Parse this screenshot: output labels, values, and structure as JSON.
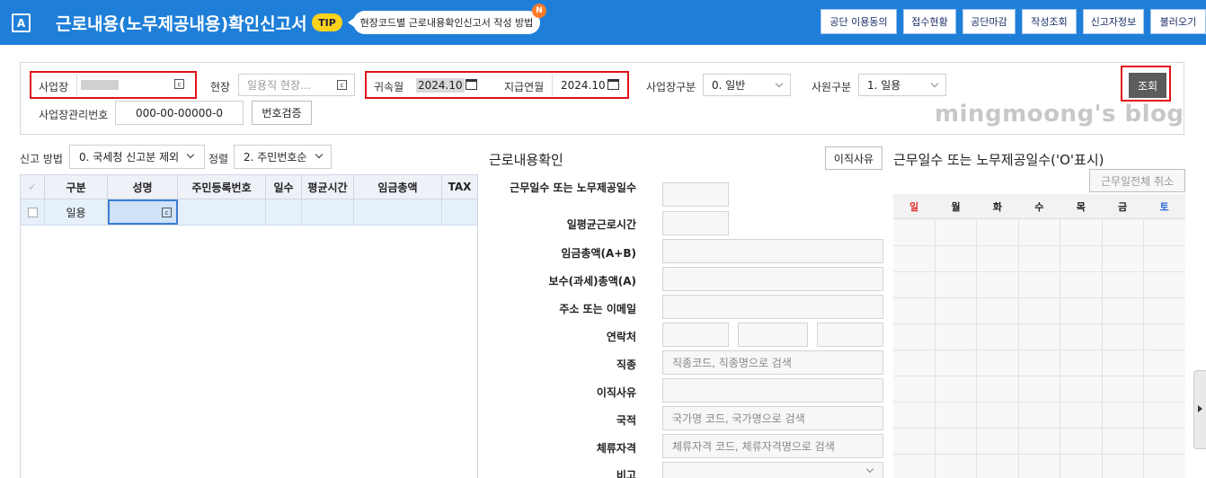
{
  "header": {
    "app_icon": "A",
    "title": "근로내용(노무제공내용)확인신고서",
    "tip_badge": "TIP",
    "tip_text": "현장코드별 근로내용확인신고서 작성 방법",
    "new_badge": "N",
    "buttons": [
      "공단 이용동의",
      "접수현황",
      "공단마감",
      "작성조회",
      "신고자정보",
      "불러오기"
    ]
  },
  "search": {
    "business_label": "사업장",
    "site_label": "현장",
    "site_placeholder": "일용직 현장…",
    "belong_month_label": "귀속월",
    "belong_month_value": "2024.10",
    "pay_month_label": "지급연월",
    "pay_month_value": "2024.10",
    "business_type_label": "사업장구분",
    "business_type_value": "0. 일반",
    "employee_type_label": "사원구분",
    "employee_type_value": "1. 일용",
    "search_button": "조회",
    "mgmt_no_label": "사업장관리번호",
    "mgmt_no_value": "000-00-00000-0",
    "verify_button": "번호검증"
  },
  "watermark": "mingmoong's blog",
  "filters": {
    "report_method_label": "신고 방법",
    "report_method_value": "0. 국세청 신고분 제외",
    "sort_label": "정렬",
    "sort_value": "2. 주민번호순"
  },
  "grid": {
    "columns": [
      "구분",
      "성명",
      "주민등록번호",
      "일수",
      "평균시간",
      "임금총액",
      "TAX"
    ],
    "rows": [
      {
        "type": "일용",
        "name": "",
        "rrn": "",
        "days": "",
        "avg_hours": "",
        "total_wage": "",
        "tax": ""
      }
    ]
  },
  "detail": {
    "title": "근로내용확인",
    "resign_reason_button": "이직사유",
    "fields": {
      "work_days": "근무일수 또는 노무제공일수",
      "daily_hours": "일평균근로시간",
      "total_wage": "임금총액(A+B)",
      "taxable_pay": "보수(과세)총액(A)",
      "address": "주소 또는 이메일",
      "contact": "연락처",
      "job": "직종",
      "resign_reason": "이직사유",
      "nationality": "국적",
      "stay_status": "체류자격",
      "note": "비고"
    },
    "placeholders": {
      "job": "직종코드, 직종명으로 검색",
      "nationality": "국가명 코드, 국가명으로 검색",
      "stay_status": "체류자격 코드, 체류자격명으로 검색"
    }
  },
  "calendar": {
    "title": "근무일수 또는 노무제공일수('O'표시)",
    "cancel_all_button": "근무일전체 취소",
    "days": [
      "일",
      "월",
      "화",
      "수",
      "목",
      "금",
      "토"
    ],
    "colors": {
      "sunday": "#e0302a",
      "saturday": "#2a6fd6",
      "weekday": "#222222"
    }
  },
  "colors": {
    "titlebar": "#1f7fd8",
    "highlight": "#e0121b",
    "selected_row": "#e6f0fb"
  }
}
